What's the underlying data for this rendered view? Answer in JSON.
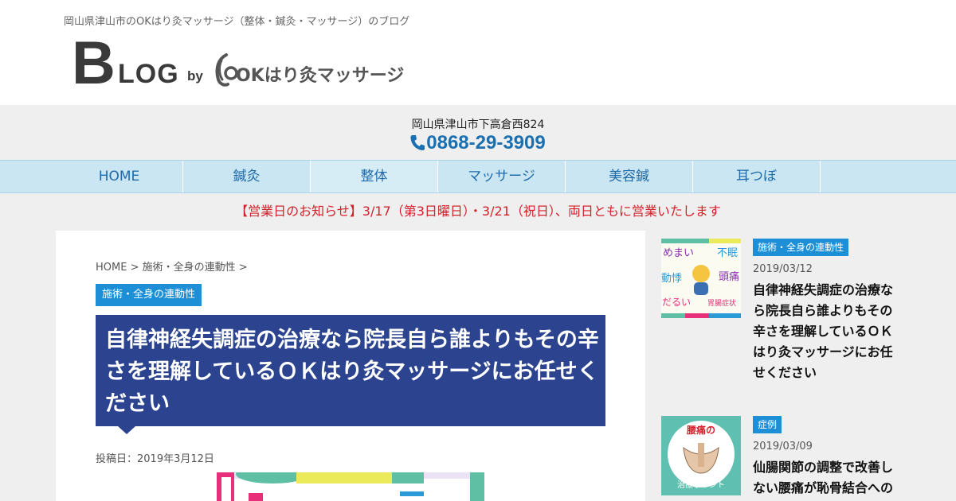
{
  "site": {
    "tagline": "岡山県津山市のOKはり灸マッサージ（整体・鍼灸・マッサージ）のブログ",
    "logo": {
      "b": "B",
      "log": "LOG",
      "by": "by",
      "brand": "OKはり灸マッサージ"
    },
    "address": "岡山県津山市下高倉西824",
    "phone": "0868-29-3909"
  },
  "nav": {
    "items": [
      {
        "label": "HOME"
      },
      {
        "label": "鍼灸"
      },
      {
        "label": "整体"
      },
      {
        "label": "マッサージ"
      },
      {
        "label": "美容鍼"
      },
      {
        "label": "耳つぼ"
      }
    ]
  },
  "notice": "【営業日のお知らせ】3/17（第3日曜日）・3/21（祝日）、両日ともに営業いたします",
  "article": {
    "breadcrumb": "HOME > 施術・全身の連動性 >",
    "category": "施術・全身の連動性",
    "title": "自律神経失調症の治療なら院長自ら誰よりもその辛さを理解しているＯＫはり灸マッサージにお任せください",
    "date": "投稿日：2019年3月12日"
  },
  "sidebar": {
    "posts": [
      {
        "category": "施術・全身の連動性",
        "date": "2019/03/12",
        "title": "自律神経失調症の治療なら院長自ら誰よりもその辛さを理解しているＯＫはり灸マッサージにお任せください",
        "thumb": {
          "w1": "めまい",
          "w2": "不眠",
          "w3": "動悸",
          "w4": "頭痛",
          "w5": "だるい",
          "w6": "胃腸症状"
        }
      },
      {
        "category": "症例",
        "date": "2019/03/09",
        "title": "仙腸関節の調整で改善しない腰痛が恥骨結合への",
        "thumb": {
          "top": "腰痛の",
          "bottom": "治療ポイント"
        }
      }
    ]
  },
  "colors": {
    "nav_bg": "#c9e6f2",
    "nav_text": "#1f6aa8",
    "badge": "#1c8fd6",
    "title_bg": "#2c4490",
    "notice": "#d1212a",
    "phone": "#1a6fb0"
  }
}
